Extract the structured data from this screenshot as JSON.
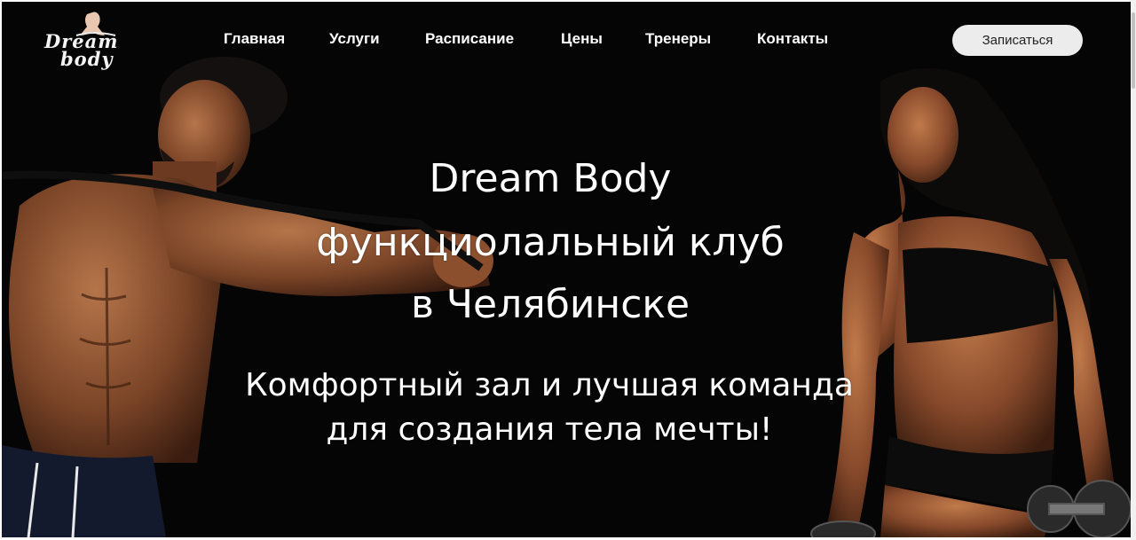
{
  "brand": {
    "logo_line1": "Dream",
    "logo_line2": "body"
  },
  "nav": {
    "items": [
      {
        "label": "Главная"
      },
      {
        "label": "Услуги"
      },
      {
        "label": "Расписание"
      },
      {
        "label": "Цены"
      },
      {
        "label": "Тренеры"
      },
      {
        "label": "Контакты"
      }
    ]
  },
  "cta": {
    "signup_label": "Записаться"
  },
  "hero": {
    "title_lines": [
      "Dream Body",
      "функциолальный клуб",
      "в Челябинске"
    ],
    "subtitle_lines": [
      "Комфортный зал и лучшая команда",
      "для создания тела мечты!"
    ]
  },
  "colors": {
    "background": "#060505",
    "text": "#ffffff",
    "button_bg": "#ececec"
  }
}
